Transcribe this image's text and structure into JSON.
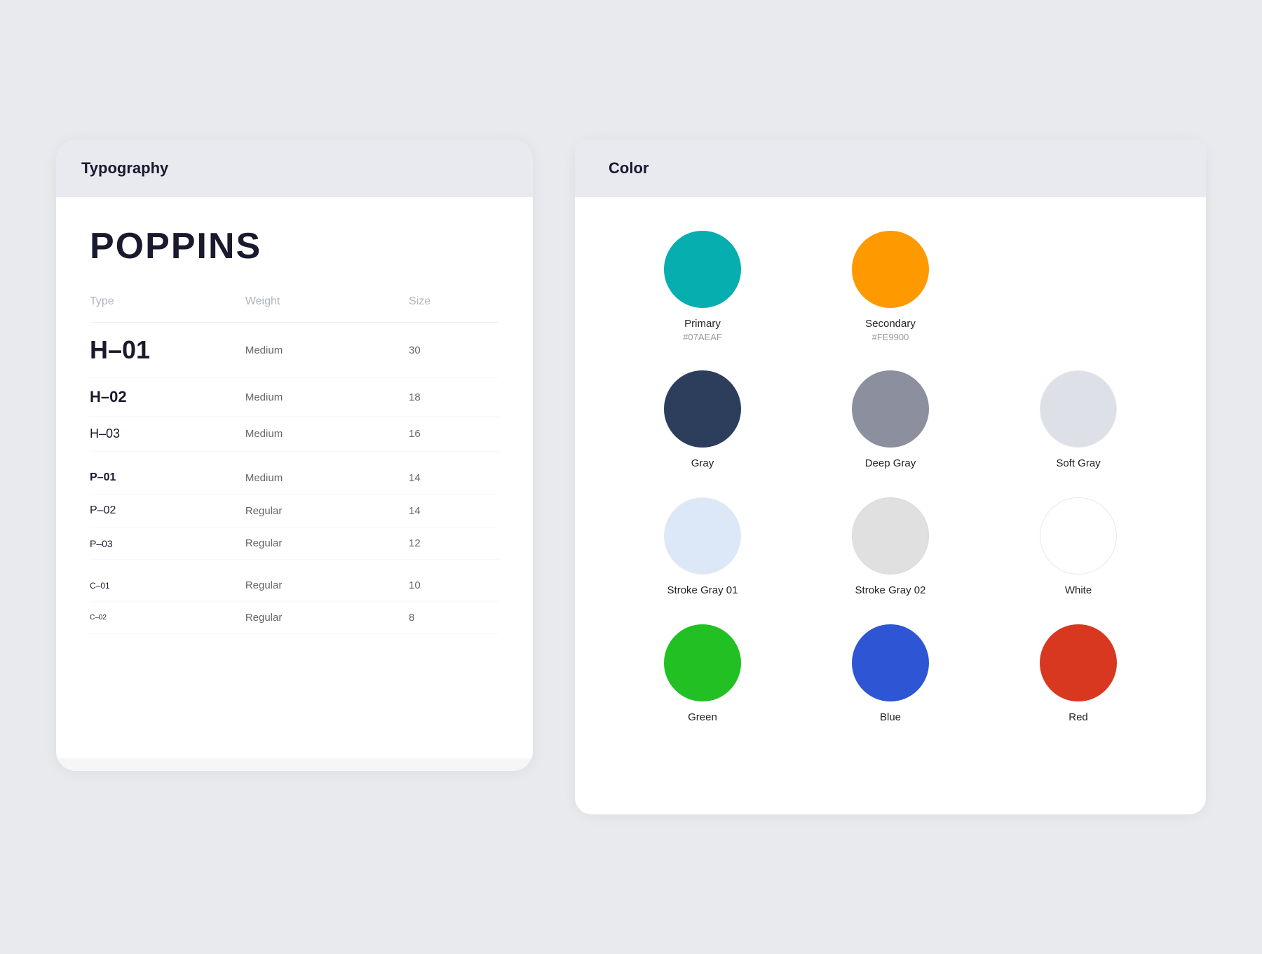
{
  "typography": {
    "title": "Typography",
    "font_name": "POPPINS",
    "table": {
      "headers": [
        "Type",
        "Weight",
        "Size"
      ],
      "rows": [
        {
          "type": "H–01",
          "weight": "Medium",
          "size": "30",
          "class": "row-h01"
        },
        {
          "type": "H–02",
          "weight": "Medium",
          "size": "18",
          "class": "row-h02"
        },
        {
          "type": "H–03",
          "weight": "Medium",
          "size": "16",
          "class": "row-h03"
        },
        {
          "type": "P–01",
          "weight": "Medium",
          "size": "14",
          "class": "row-p01"
        },
        {
          "type": "P–02",
          "weight": "Regular",
          "size": "14",
          "class": "row-p02"
        },
        {
          "type": "P–03",
          "weight": "Regular",
          "size": "12",
          "class": "row-p03"
        },
        {
          "type": "C–01",
          "weight": "Regular",
          "size": "10",
          "class": "row-c01"
        },
        {
          "type": "C–02",
          "weight": "Regular",
          "size": "8",
          "class": "row-c02"
        }
      ]
    }
  },
  "colors": {
    "title": "Color",
    "swatches": [
      {
        "name": "Primary",
        "hex": "#07AEAF",
        "class": "swatch-primary"
      },
      {
        "name": "Secondary",
        "hex": "#FE9900",
        "class": "swatch-secondary"
      },
      {
        "name": "",
        "hex": "",
        "class": ""
      },
      {
        "name": "Gray",
        "hex": "",
        "class": "swatch-gray"
      },
      {
        "name": "Deep Gray",
        "hex": "",
        "class": "swatch-deep-gray"
      },
      {
        "name": "Soft Gray",
        "hex": "",
        "class": "swatch-soft-gray"
      },
      {
        "name": "Stroke Gray 01",
        "hex": "",
        "class": "swatch-stroke-gray-01"
      },
      {
        "name": "Stroke Gray 02",
        "hex": "",
        "class": "swatch-stroke-gray-02"
      },
      {
        "name": "White",
        "hex": "",
        "class": "swatch-white"
      },
      {
        "name": "Green",
        "hex": "",
        "class": "swatch-green"
      },
      {
        "name": "Blue",
        "hex": "",
        "class": "swatch-blue"
      },
      {
        "name": "Red",
        "hex": "",
        "class": "swatch-red"
      }
    ]
  }
}
